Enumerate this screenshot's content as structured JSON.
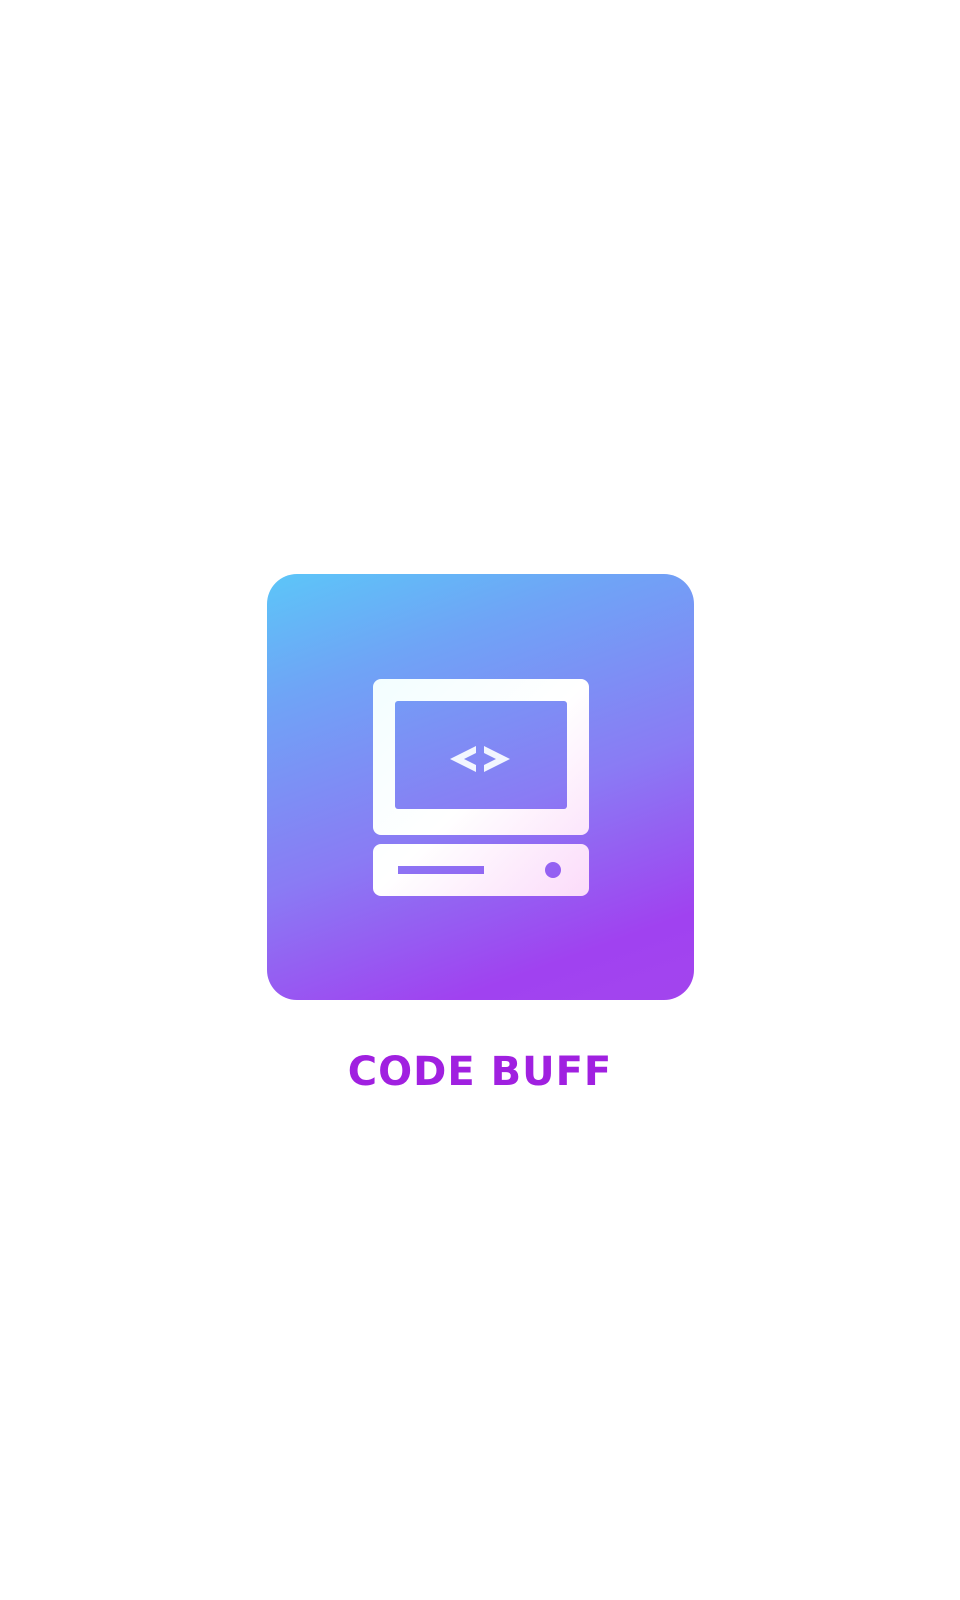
{
  "app": {
    "name": "CODE BUFF",
    "logo_icon": "computer-code-icon"
  },
  "colors": {
    "background": "#ffffff",
    "title": "#a020e0",
    "gradient_start": "#5cc6f8",
    "gradient_end": "#a345ee"
  }
}
